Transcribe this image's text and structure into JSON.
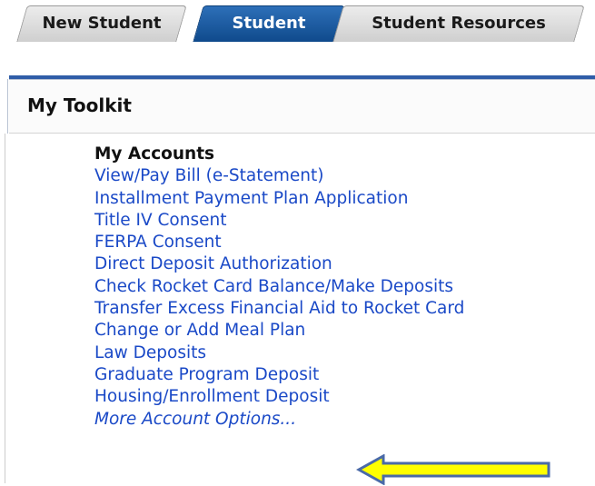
{
  "tabs": [
    {
      "label": "New Student",
      "active": false
    },
    {
      "label": "Student",
      "active": true
    },
    {
      "label": "Student Resources",
      "active": false
    }
  ],
  "toolkit": {
    "title": "My Toolkit",
    "section_heading": "My Accounts",
    "links": [
      "View/Pay Bill (e-Statement)",
      "Installment Payment Plan Application",
      "Title IV Consent",
      "FERPA Consent",
      "Direct Deposit Authorization",
      "Check Rocket Card Balance/Make Deposits",
      "Transfer Excess Financial Aid to Rocket Card",
      "Change or Add Meal Plan",
      "Law Deposits",
      "Graduate Program Deposit",
      "Housing/Enrollment Deposit"
    ],
    "more_link": "More Account Options..."
  },
  "annotation": {
    "icon": "arrow-left-icon",
    "fill": "#ffff00",
    "stroke": "#4a6aa8"
  },
  "colors": {
    "link": "#1a49c7",
    "tab_active": "#1a5aa0",
    "rule": "#2f5da8"
  }
}
